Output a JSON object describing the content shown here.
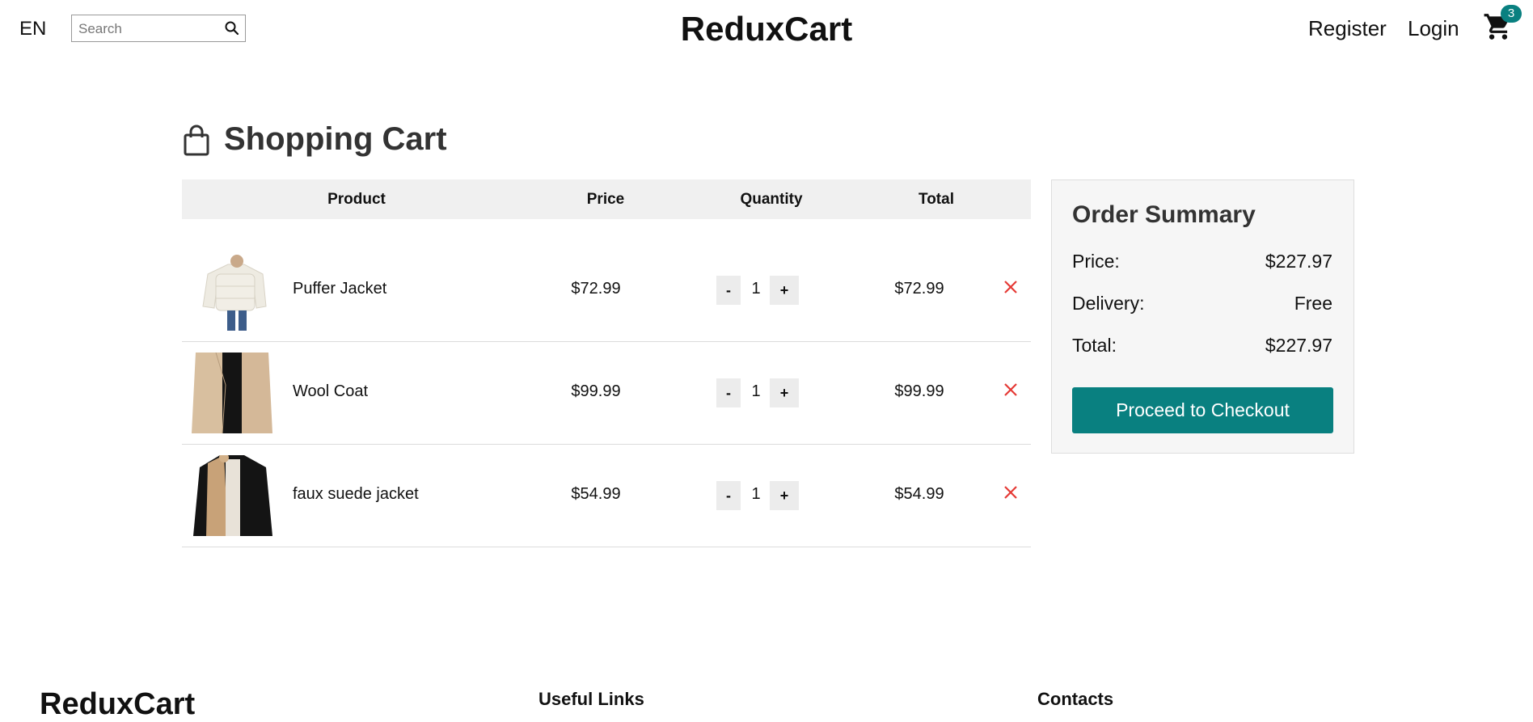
{
  "header": {
    "lang": "EN",
    "search_placeholder": "Search",
    "brand": "ReduxCart",
    "register": "Register",
    "login": "Login",
    "cart_count": "3",
    "accent": "#098080"
  },
  "cart": {
    "title": "Shopping Cart",
    "columns": [
      "Product",
      "Price",
      "Quantity",
      "Total"
    ],
    "items": [
      {
        "name": "Puffer Jacket",
        "price": "$72.99",
        "qty": "1",
        "total": "$72.99"
      },
      {
        "name": "Wool Coat",
        "price": "$99.99",
        "qty": "1",
        "total": "$99.99"
      },
      {
        "name": "faux suede jacket",
        "price": "$54.99",
        "qty": "1",
        "total": "$54.99"
      }
    ],
    "minus": "-",
    "plus": "+"
  },
  "summary": {
    "title": "Order Summary",
    "price_label": "Price:",
    "price_value": "$227.97",
    "delivery_label": "Delivery:",
    "delivery_value": "Free",
    "total_label": "Total:",
    "total_value": "$227.97",
    "checkout": "Proceed to Checkout"
  },
  "footer": {
    "brand": "ReduxCart",
    "useful_links": "Useful Links",
    "contacts": "Contacts"
  }
}
